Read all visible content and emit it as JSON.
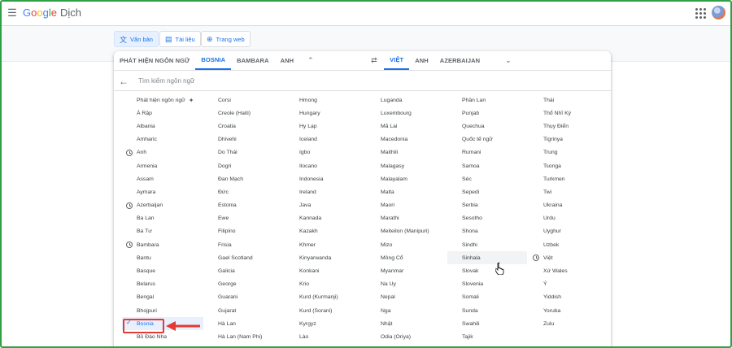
{
  "app": {
    "logo_word": "Google",
    "product": "Dịch"
  },
  "colors": {
    "accent": "#1a73e8",
    "highlight_box": "#e53935",
    "frame": "#2ea043"
  },
  "icons": {
    "menu": "hamburger-menu-icon",
    "apps": "google-apps-icon",
    "back": "arrow-back-icon",
    "swap": "swap-icon",
    "history": "history-icon",
    "check": "check-icon",
    "sparkle": "sparkle-icon"
  },
  "modes": [
    {
      "label": "Văn bản",
      "icon": "translate-icon",
      "active": true
    },
    {
      "label": "Tài liệu",
      "icon": "document-icon",
      "active": false
    },
    {
      "label": "Trang web",
      "icon": "globe-icon",
      "active": false
    }
  ],
  "source_tabs": [
    "PHÁT HIỆN NGÔN NGỮ",
    "BOSNIA",
    "BAMBARA",
    "ANH"
  ],
  "target_tabs": [
    "VIỆT",
    "ANH",
    "AZERBAIJAN"
  ],
  "search": {
    "placeholder": "Tìm kiếm ngôn ngữ"
  },
  "languages": [
    "Phát hiện ngôn ngữ",
    "Á Rập",
    "Albania",
    "Amharic",
    "Anh",
    "Armenia",
    "Assam",
    "Aymara",
    "Azerbaijan",
    "Ba Lan",
    "Ba Tư",
    "Bambara",
    "Bantu",
    "Basque",
    "Belarus",
    "Bengal",
    "Bhojpuri",
    "Bosnia",
    "Bồ Đào Nha",
    "Corsi",
    "Creole (Haiti)",
    "Croatia",
    "Dhivehi",
    "Do Thái",
    "Dogri",
    "Đan Mạch",
    "Đức",
    "Estonia",
    "Ewe",
    "Filipino",
    "Frisia",
    "Gael Scotland",
    "Galicia",
    "George",
    "Guarani",
    "Gujarat",
    "Hà Lan",
    "Hà Lan (Nam Phi)",
    "Hmong",
    "Hungary",
    "Hy Lạp",
    "Iceland",
    "Igbo",
    "Ilocano",
    "Indonesia",
    "Ireland",
    "Java",
    "Kannada",
    "Kazakh",
    "Khmer",
    "Kinyarwanda",
    "Konkani",
    "Krio",
    "Kurd (Kurmanji)",
    "Kurd (Sorani)",
    "Kyrgyz",
    "Lào",
    "Luganda",
    "Luxembourg",
    "Mã Lai",
    "Macedonia",
    "Maithili",
    "Malagasy",
    "Malayalam",
    "Malta",
    "Maori",
    "Marathi",
    "Meiteilon (Manipuri)",
    "Mizo",
    "Mông Cổ",
    "Myanmar",
    "Na Uy",
    "Nepal",
    "Nga",
    "Nhật",
    "Odia (Oriya)",
    "Phần Lan",
    "Punjab",
    "Quechua",
    "Quốc tế ngữ",
    "Rumani",
    "Samoa",
    "Séc",
    "Sepedi",
    "Serbia",
    "Sesotho",
    "Shona",
    "Sindhi",
    "Sinhala",
    "Slovak",
    "Slovenia",
    "Somali",
    "Sunda",
    "Swahili",
    "Tajik",
    "Thái",
    "Thổ Nhĩ Kỳ",
    "Thụy Điển",
    "Tigrinya",
    "Trung",
    "Tsonga",
    "Turkmen",
    "Twi",
    "Ukraina",
    "Urdu",
    "Uyghur",
    "Uzbek",
    "Việt",
    "Xứ Wales",
    "Ý",
    "Yiddish",
    "Yoruba",
    "Zulu",
    ""
  ],
  "recent_languages": [
    "Anh",
    "Azerbaijan",
    "Bambara",
    "Việt"
  ],
  "selected_language": "Bosnia",
  "hovered_language": "Sinhala"
}
